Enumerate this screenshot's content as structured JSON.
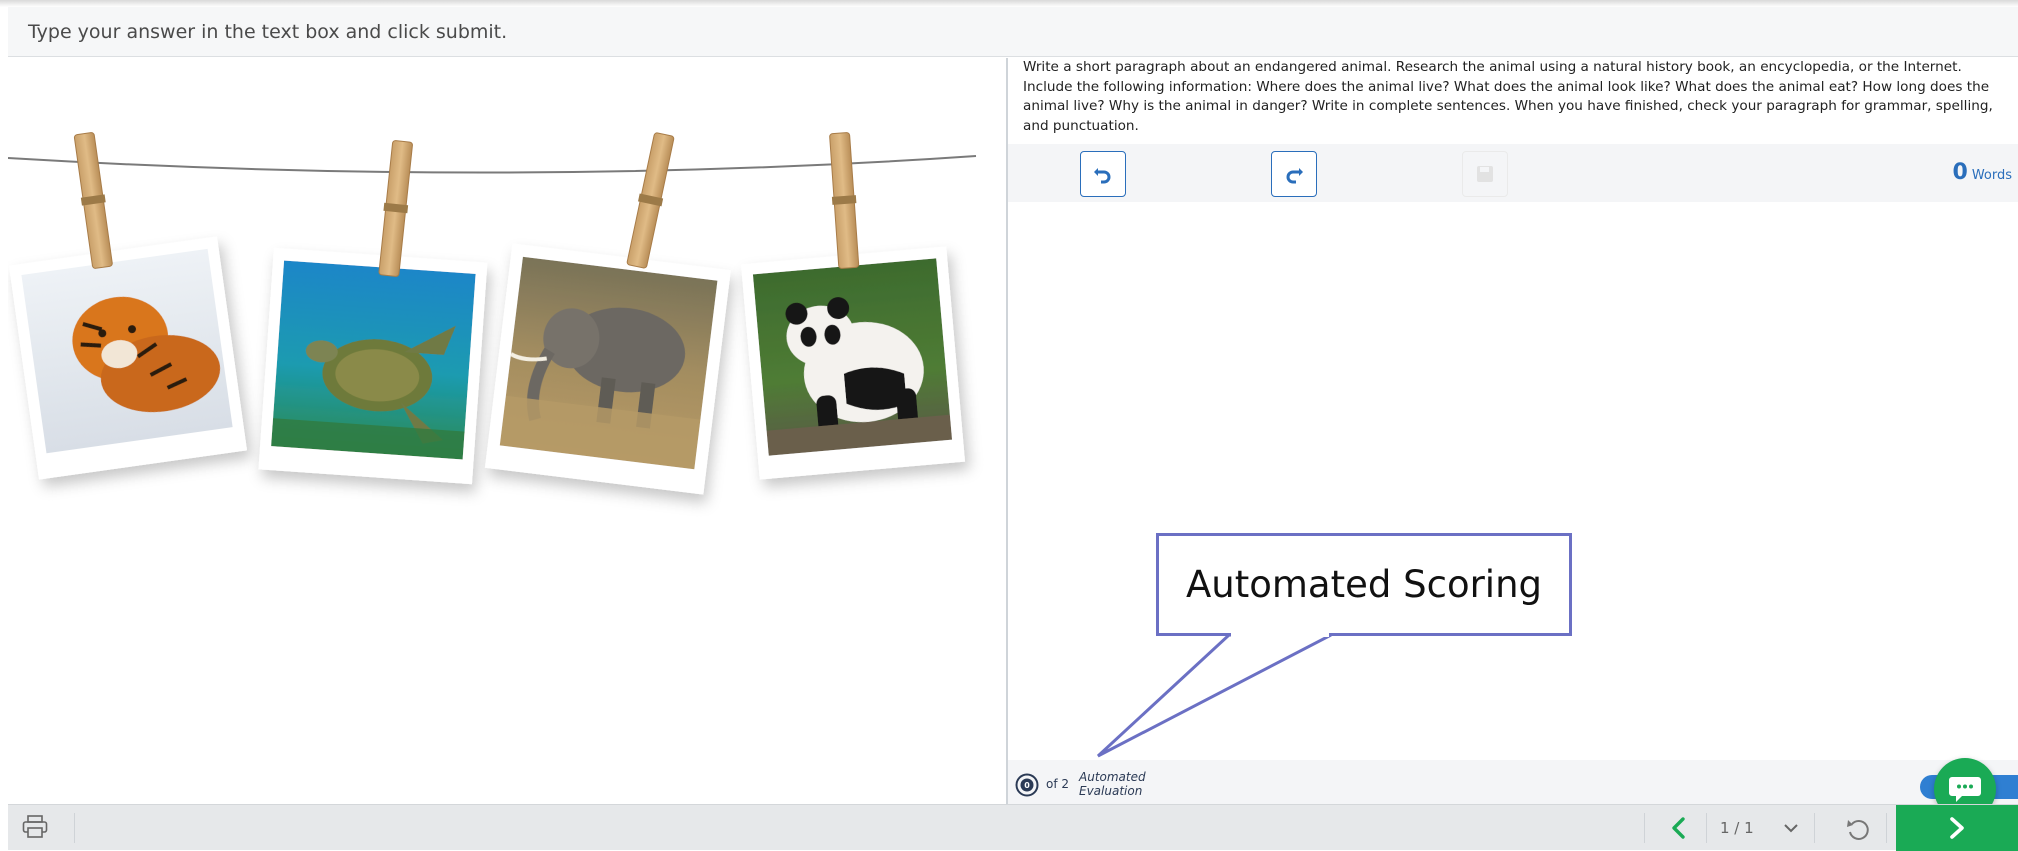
{
  "instruction": {
    "text": "Type your answer in the text box and click submit."
  },
  "prompt": {
    "text": "Write a short paragraph about an endangered animal. Research the animal using a natural history book, an encyclopedia, or the Internet. Include the following information: Where does the animal live? What does the animal look like? What does the animal eat? How long does the animal live? Why is the animal in danger? Write in complete sentences. When you have finished, check your paragraph for grammar, spelling, and punctuation."
  },
  "toolbar": {
    "undo_icon": "undo-icon",
    "redo_icon": "redo-icon",
    "save_icon": "save-icon",
    "word_count": "0",
    "word_count_unit": "Words"
  },
  "image": {
    "photos": [
      "tiger",
      "sea turtle",
      "elephant",
      "panda"
    ]
  },
  "evaluation": {
    "badge_number": "0",
    "of_text": "of 2",
    "label_line1": "Automated",
    "label_line2": "Evaluation"
  },
  "callout": {
    "text": "Automated Scoring"
  },
  "pagination": {
    "text": "1 / 1"
  },
  "colors": {
    "accent_blue": "#2a6ebb",
    "green": "#1aaa55",
    "callout_border": "#6b70c4"
  }
}
